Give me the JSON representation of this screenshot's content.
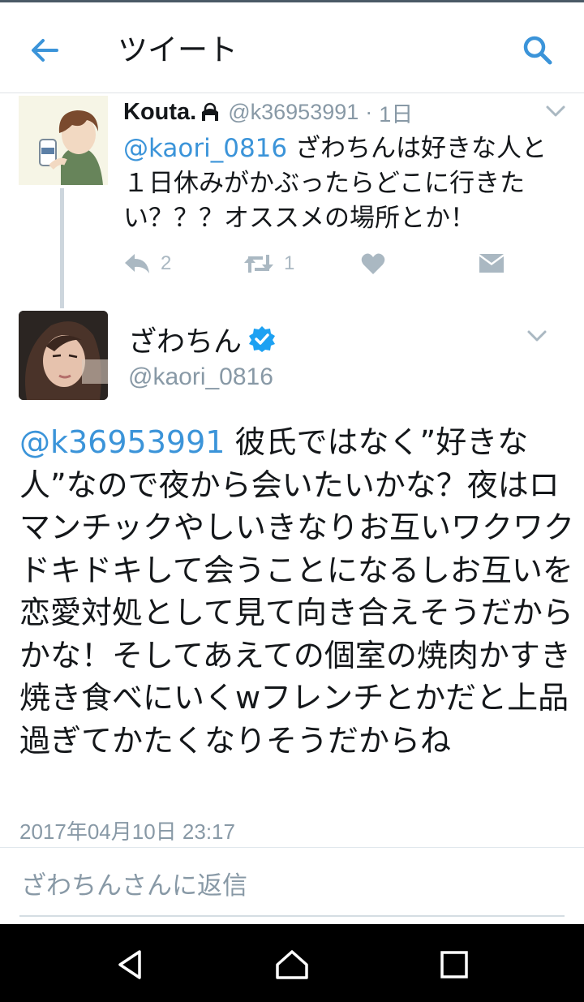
{
  "appbar": {
    "title": "ツイート",
    "back_icon": "back-arrow-icon",
    "search_icon": "search-icon",
    "accent": "#3b94d9"
  },
  "parent_tweet": {
    "name": "Kouta.",
    "name_icon": "lock-icon",
    "handle": "@k36953991",
    "time": "1日",
    "mention": "@kaori_0816",
    "text": " ざわちんは好きな人と１日休みがかぶったらどこに行きたい？？？オススメの場所とか！",
    "actions": {
      "reply_count": "2",
      "retweet_count": "1"
    }
  },
  "main_tweet": {
    "name": "ざわちん",
    "verified_icon": "verified-badge-icon",
    "handle": "@kaori_0816",
    "mention": "@k36953991",
    "text": " 彼氏ではなく”好きな人”なので夜から会いたいかな？夜はロマンチックやしいきなりお互いワクワクドキドキして会うことになるしお互いを恋愛対処として見て向き合えそうだからかな！そしてあえての個室の焼肉かすき焼き食べにいくwフレンチとかだと上品過ぎてかたくなりそうだからね",
    "timestamp": "2017年04月10日 23:17"
  },
  "reply": {
    "placeholder": "ざわちんさんに返信"
  },
  "navbar": {
    "icons": [
      "back-triangle-icon",
      "home-icon",
      "recents-square-icon"
    ]
  }
}
